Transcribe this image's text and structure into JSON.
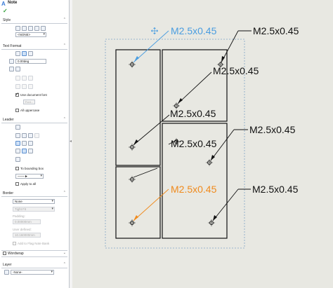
{
  "panel": {
    "title": "Note",
    "sections": {
      "style": "Style",
      "text_format": "Text Format",
      "leader": "Leader",
      "border": "Border",
      "wordwrap": "Wordwrap",
      "layer": "Layer"
    },
    "style_select": "<NONE>",
    "angle_value": "0.00deg",
    "use_document_font": "Use document font",
    "font_button": "Font...",
    "all_uppercase": "All uppercase",
    "to_bounding_box": "To bounding box",
    "apply_to_all": "Apply to all",
    "border_style": "None",
    "border_size": "Tight Fit",
    "padding_label": "Padding:",
    "padding_value": "0.00000mm",
    "user_defined_label": "User defined:",
    "user_defined_value": "10.160000mm",
    "flag_note_bank": "Add to Flag Note Bank",
    "layer_value": "-None-"
  },
  "canvas": {
    "background": "#e8e8e2",
    "selected_color": "#4a9de0",
    "highlight_color": "#f08a1c",
    "notes": [
      {
        "text": "M2.5x0.45",
        "state": "selected"
      },
      {
        "text": "M2.5x0.45",
        "state": "normal"
      },
      {
        "text": "M2.5x0.45",
        "state": "normal"
      },
      {
        "text": "M2.5x0.45",
        "state": "normal"
      },
      {
        "text": "M2.5x0.45",
        "state": "normal"
      },
      {
        "text": "M2.5x0.45",
        "state": "normal"
      },
      {
        "text": "M2.5x0.45",
        "state": "highlighted"
      },
      {
        "text": "M2.5x0.45",
        "state": "normal"
      }
    ]
  }
}
